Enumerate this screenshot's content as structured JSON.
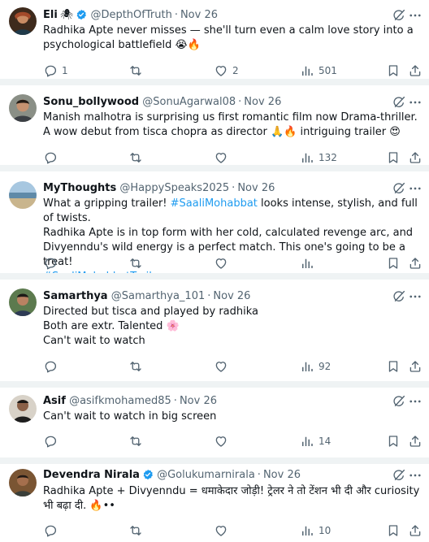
{
  "tweets": [
    {
      "name": "Eli",
      "name_suffix": "🕷",
      "verified": true,
      "handle": "@DepthOfTruth",
      "time": "Nov 26",
      "text": "Radhika Apte never misses — she'll turn even a calm love story into a psychological battlefield 😭🔥",
      "replies": "1",
      "retweets": "",
      "likes": "2",
      "views": "501"
    },
    {
      "name": "Sonu_bollywood",
      "verified": false,
      "handle": "@SonuAgarwal08",
      "time": "Nov 26",
      "text": "Manish malhotra is surprising us first romantic film now Drama-thriller. A wow debut from tisca chopra as director 🙏🔥 intriguing trailer 😍",
      "replies": "",
      "retweets": "",
      "likes": "",
      "views": "132"
    },
    {
      "name": "MyThoughts",
      "verified": false,
      "handle": "@HappySpeaks2025",
      "time": "Nov 26",
      "text_parts": [
        {
          "pre": "What a gripping trailer! ",
          "tag": "#SaaliMohabbat",
          "post": " looks intense, stylish, and full of twists."
        },
        {
          "pre": "Radhika Apte is in top form with her cold, calculated revenge arc, and Divyenndu's wild energy is a perfect match. This one's going to be a treat!",
          "tag": "",
          "post": ""
        },
        {
          "pre": "",
          "tag": "#SaaliMohabbatTrailer",
          "post": ""
        }
      ],
      "replies": "",
      "retweets": "",
      "likes": "",
      "views": ""
    },
    {
      "name": "Samarthya",
      "verified": false,
      "handle": "@Samarthya_101",
      "time": "Nov 26",
      "lines": [
        "Directed but tisca and played by radhika",
        "Both are extr. Talented 🌸",
        "Can't wait to watch"
      ],
      "replies": "",
      "retweets": "",
      "likes": "",
      "views": "92"
    },
    {
      "name": "Asif",
      "verified": false,
      "handle": "@asifkmohamed85",
      "time": "Nov 26",
      "text": "Can't wait to watch in big screen",
      "replies": "",
      "retweets": "",
      "likes": "",
      "views": "14"
    },
    {
      "name": "Devendra Nirala",
      "verified": true,
      "handle": "@Golukumarnirala",
      "time": "Nov 26",
      "text": "Radhika Apte + Divyenndu = धमाकेदार जोड़ी! ट्रेलर ने तो टेंशन भी दी और curiosity भी बढ़ा दी. 🔥••",
      "replies": "",
      "retweets": "",
      "likes": "",
      "views": "10"
    }
  ],
  "icons": [
    "reply-icon",
    "retweet-icon",
    "like-icon",
    "views-icon",
    "bookmark-icon",
    "share-icon",
    "grok-icon",
    "more-icon",
    "verified-badge-icon"
  ],
  "colors": {
    "text": "#0f1419",
    "secondary": "#536471",
    "link": "#1d9bf0",
    "separator": "#eff3f4"
  }
}
